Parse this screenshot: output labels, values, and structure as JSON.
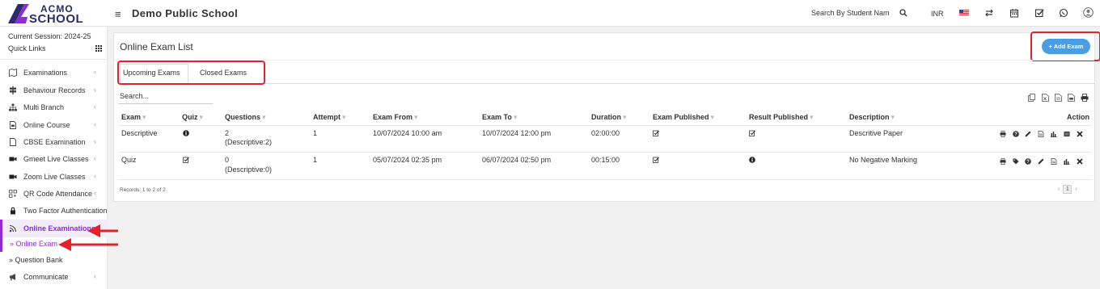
{
  "brand": {
    "logo_top": "ACMO",
    "logo_bottom": "SCHOOL"
  },
  "header": {
    "school_name": "Demo Public School",
    "search_placeholder": "Search By Student Nam",
    "currency": "INR"
  },
  "sidebar": {
    "session": "Current Session: 2024-25",
    "quick_links": "Quick Links",
    "items": [
      {
        "label": "Examinations",
        "icon": "map-icon",
        "chevron": "‹"
      },
      {
        "label": "Behaviour Records",
        "icon": "signpost-icon",
        "chevron": "‹"
      },
      {
        "label": "Multi Branch",
        "icon": "sitemap-icon",
        "chevron": "‹"
      },
      {
        "label": "Online Course",
        "icon": "file-video-icon",
        "chevron": "‹"
      },
      {
        "label": "CBSE Examination",
        "icon": "file-icon",
        "chevron": "‹"
      },
      {
        "label": "Gmeet Live Classes",
        "icon": "video-camera-icon",
        "chevron": "‹"
      },
      {
        "label": "Zoom Live Classes",
        "icon": "video-camera-icon",
        "chevron": "‹"
      },
      {
        "label": "QR Code Attendance",
        "icon": "qrcode-icon",
        "chevron": "‹"
      },
      {
        "label": "Two Factor Authentication",
        "icon": "lock-icon",
        "chevron": ""
      },
      {
        "label": "Online Examinations",
        "icon": "rss-icon",
        "chevron": ""
      }
    ],
    "subitems": [
      {
        "label": "» Online Exam"
      },
      {
        "label": "» Question Bank"
      }
    ],
    "communicate": {
      "label": "Communicate",
      "chevron": "‹"
    }
  },
  "main": {
    "title": "Online Exam List",
    "add_button": "+ Add Exam",
    "tabs": [
      {
        "label": "Upcoming Exams"
      },
      {
        "label": "Closed Exams"
      }
    ],
    "search_placeholder": "Search...",
    "columns": [
      "Exam",
      "Quiz",
      "Questions",
      "Attempt",
      "Exam From",
      "Exam To",
      "Duration",
      "Exam Published",
      "Result Published",
      "Description",
      "Action"
    ],
    "rows": [
      {
        "exam": "Descriptive",
        "quiz_icon": "info-circle-icon",
        "questions": "2",
        "questions_detail": "(Descriptive:2)",
        "attempt": "1",
        "exam_from": "10/07/2024 10:00 am",
        "exam_to": "10/07/2024 12:00 pm",
        "duration": "02:00:00",
        "exam_published_icon": "checkbox-checked-icon",
        "result_published_icon": "checkbox-checked-icon",
        "description": "Descritive Paper"
      },
      {
        "exam": "Quiz",
        "quiz_icon": "checkbox-checked-icon",
        "questions": "0",
        "questions_detail": "(Descriptive:0)",
        "attempt": "1",
        "exam_from": "05/07/2024 02:35 pm",
        "exam_to": "06/07/2024 02:50 pm",
        "duration": "00:15:00",
        "exam_published_icon": "checkbox-checked-icon",
        "result_published_icon": "info-circle-icon",
        "description": "No Negative Marking"
      }
    ],
    "records_text": "Records: 1 to 2 of 2",
    "pagination": {
      "prev": "‹",
      "current": "1",
      "next": "›"
    }
  },
  "colors": {
    "accent": "#8e2cd3",
    "button": "#4a9de2",
    "highlight": "#e8202a"
  }
}
